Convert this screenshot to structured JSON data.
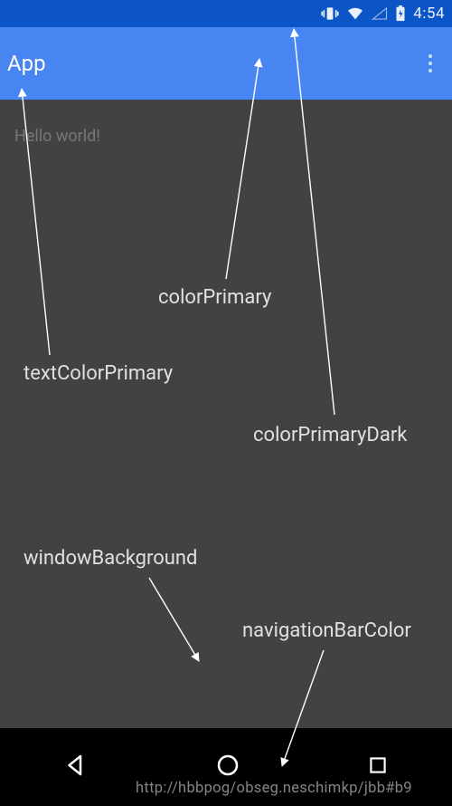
{
  "status": {
    "clock": "4:54"
  },
  "appbar": {
    "title": "App"
  },
  "body": {
    "hello": "Hello world!"
  },
  "labels": {
    "colorPrimary": "colorPrimary",
    "textColorPrimary": "textColorPrimary",
    "colorPrimaryDark": "colorPrimaryDark",
    "windowBackground": "windowBackground",
    "navigationBarColor": "navigationBarColor"
  },
  "watermark": "http://hbbpog/obseg.neschimkp/jbb#b9",
  "theme": {
    "colorPrimaryDark": "#0c55c7",
    "colorPrimary": "#4786f2",
    "textColorPrimary": "#ffffff",
    "windowBackground": "#424242",
    "navigationBarColor": "#000000"
  }
}
